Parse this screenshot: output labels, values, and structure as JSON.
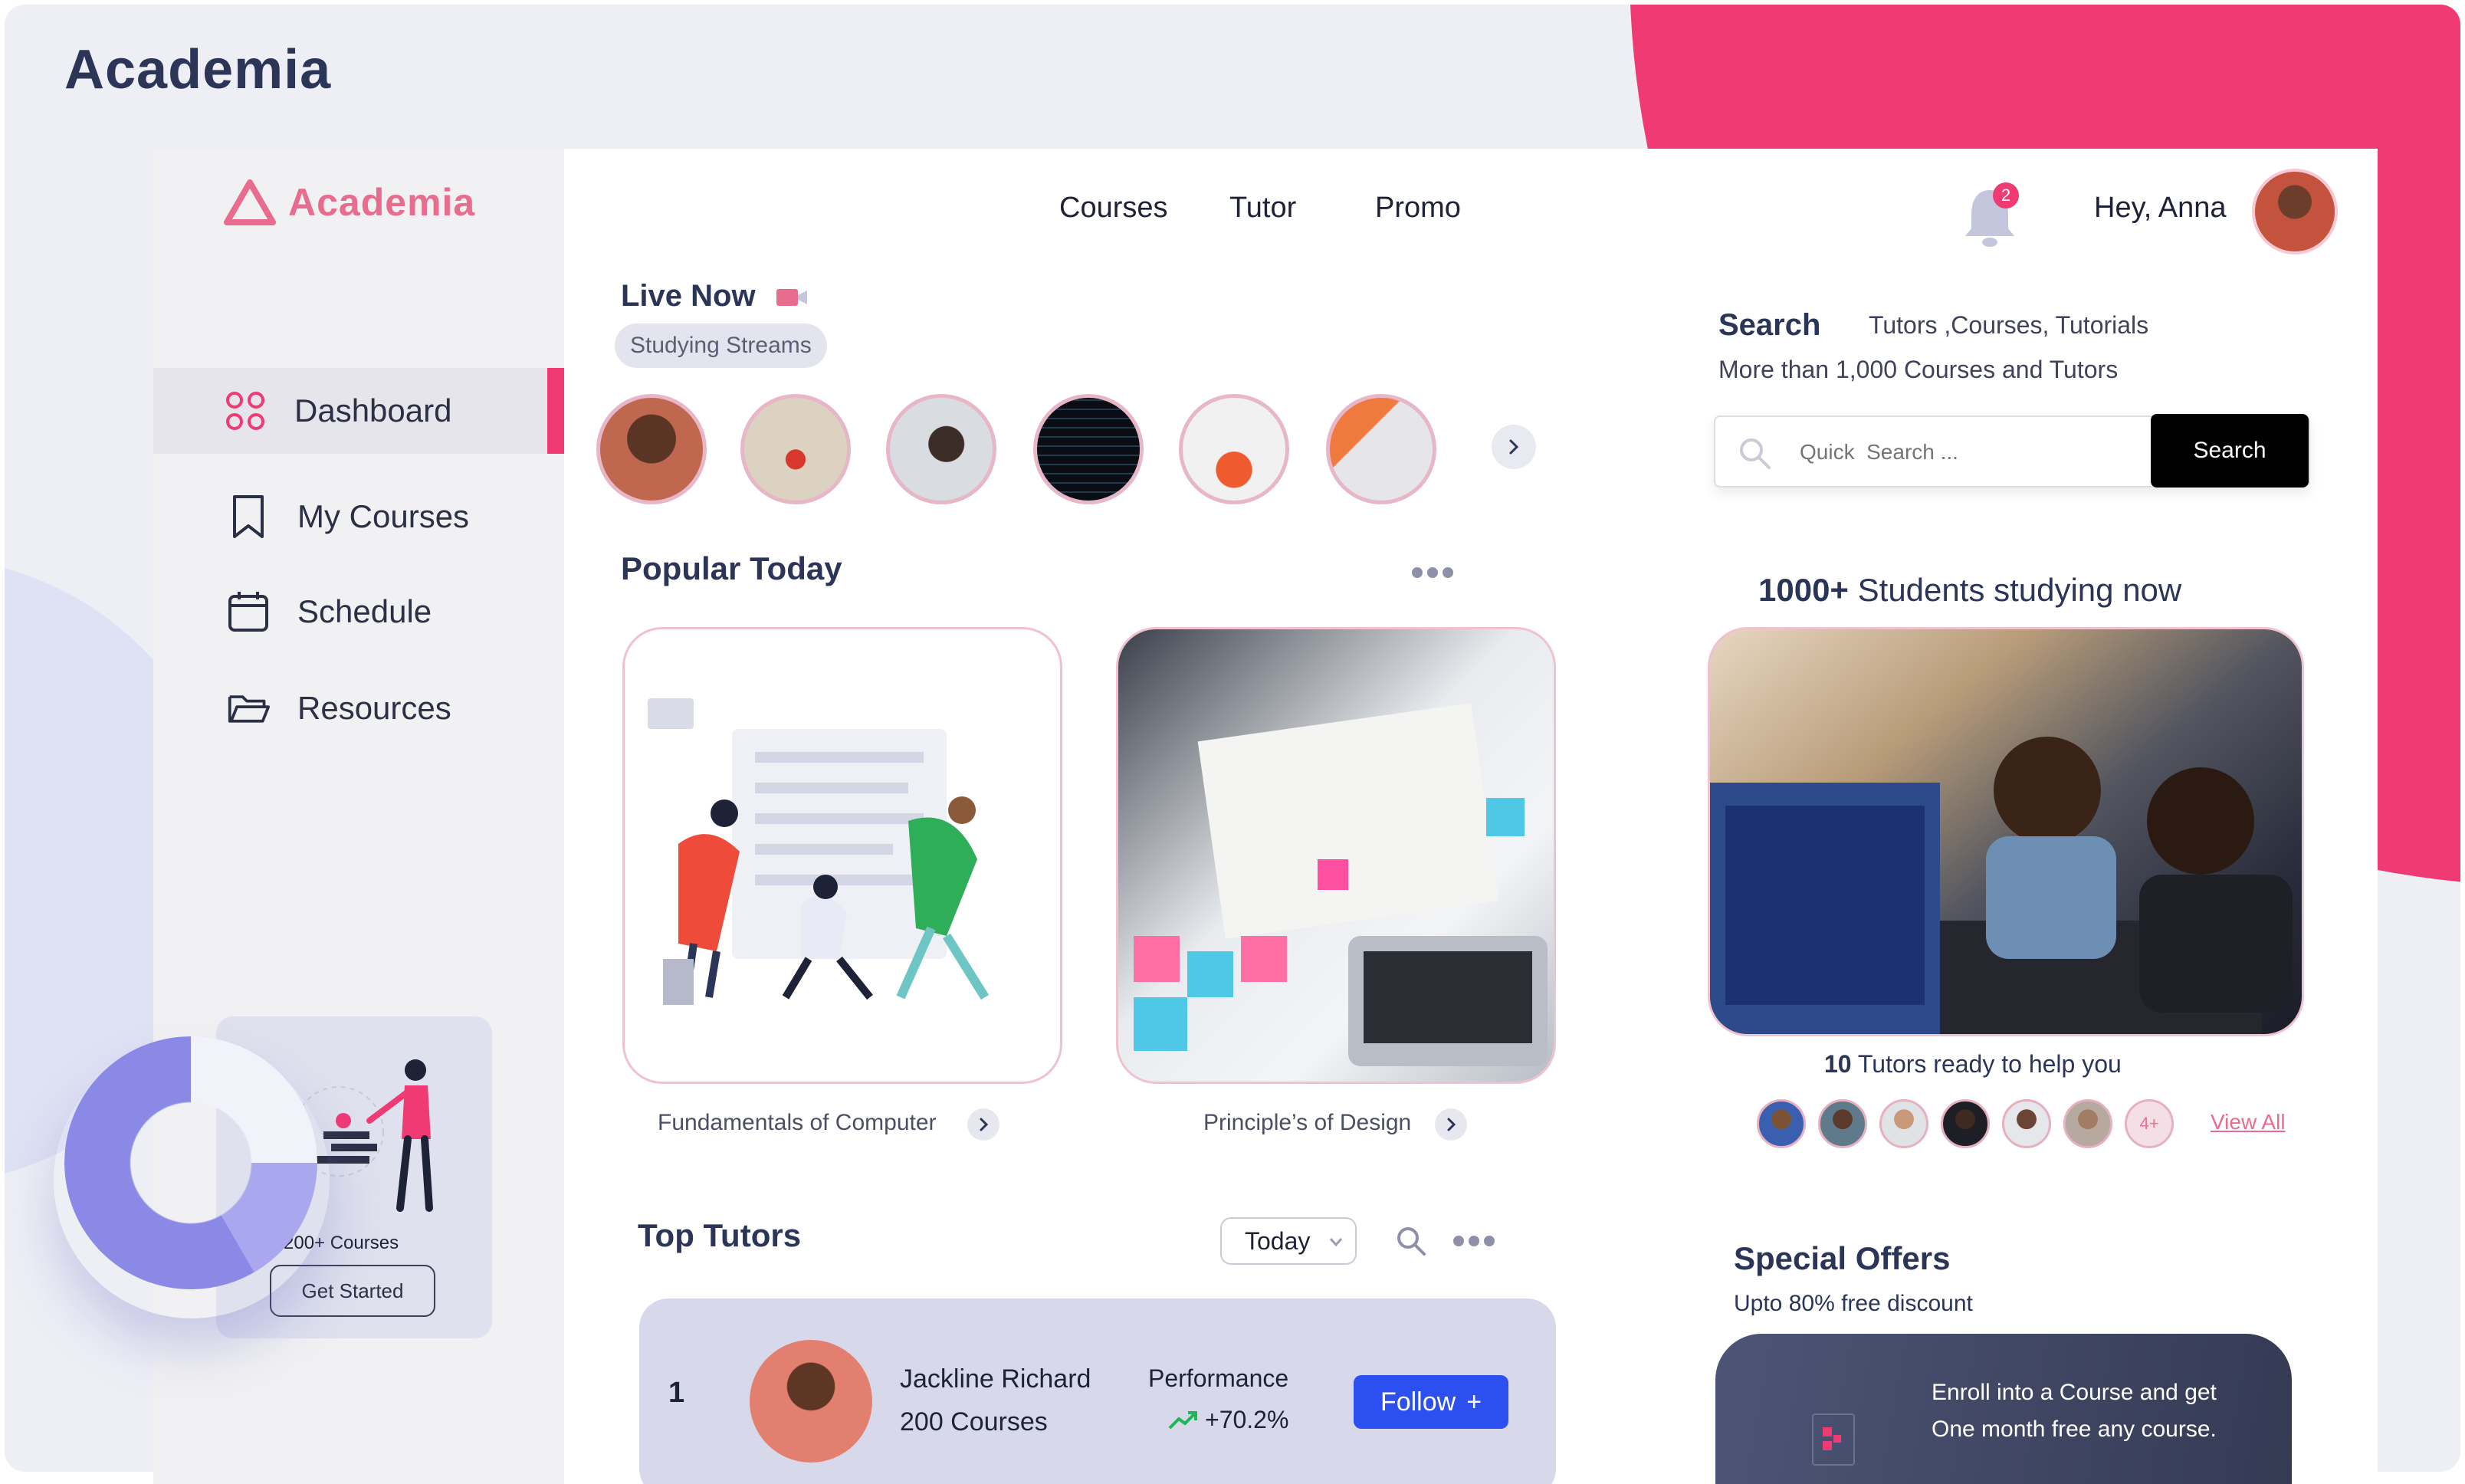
{
  "app": {
    "title": "Academia",
    "brand": "Academia"
  },
  "sidebar": {
    "items": [
      {
        "label": "Dashboard",
        "icon": "grid-dots-icon",
        "active": true
      },
      {
        "label": "My Courses",
        "icon": "bookmark-icon"
      },
      {
        "label": "Schedule",
        "icon": "calendar-icon"
      },
      {
        "label": "Resources",
        "icon": "folder-icon"
      }
    ],
    "promo": {
      "courses_label": "200+ Courses",
      "button_label": "Get Started"
    }
  },
  "header": {
    "nav": [
      "Courses",
      "Tutor",
      "Promo"
    ],
    "notifications": "2",
    "greeting": "Hey, Anna"
  },
  "live": {
    "title": "Live Now",
    "chip": "Studying Streams",
    "streams": [
      "stream-1",
      "stream-2",
      "stream-3",
      "stream-4",
      "stream-5",
      "stream-6"
    ]
  },
  "popular": {
    "title": "Popular  Today",
    "cards": [
      {
        "label": "Fundamentals  of Computer"
      },
      {
        "label": "Principle’s of Design"
      }
    ]
  },
  "top_tutors": {
    "title": "Top Tutors",
    "filter": "Today",
    "rows": [
      {
        "rank": "1",
        "name": "Jackline Richard",
        "courses": "200 Courses",
        "performance_label": "Performance",
        "performance_value": "+70.2%",
        "follow_label": "Follow"
      }
    ]
  },
  "search": {
    "title": "Search",
    "subtitle": "Tutors ,Courses, Tutorials",
    "subtitle2": "More than  1,000 Courses and Tutors",
    "placeholder": "Quick  Search ...",
    "button_label": "Search"
  },
  "students": {
    "count": "1000+",
    "text": " Students studying now",
    "tutors_count": "10",
    "tutors_text": " Tutors ready to help you",
    "more_badge": "4+",
    "view_all": "View All"
  },
  "special": {
    "title": "Special Offers",
    "subtitle": "Upto 80% free discount",
    "line1": "Enroll into a Course and get",
    "line2": "One month free any course."
  },
  "colors": {
    "accent": "#ef3a74",
    "brand_text": "#e86c8e",
    "primary_button": "#2b50ef",
    "heading": "#2b3557"
  }
}
